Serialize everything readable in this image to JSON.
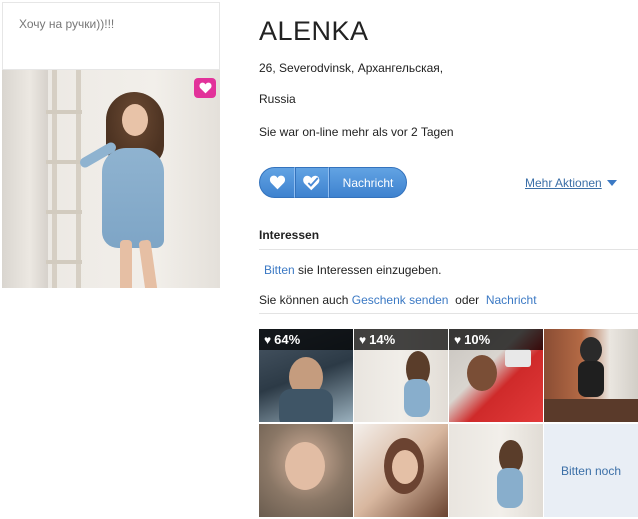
{
  "status_text": "Хочу на ручки))!!!",
  "profile": {
    "name": "ALENKA",
    "age_location": "26,  Severodvinsk, Архангельская,",
    "country": "Russia",
    "online_status": "Sie war on-line mehr als vor 2 Tagen"
  },
  "actions": {
    "message_label": "Nachricht",
    "more_actions_label": "Mehr Aktionen"
  },
  "interests": {
    "title": "Interessen",
    "prompt_link": "Bitten",
    "prompt_rest": " sie Interessen einzugeben.",
    "alt_prefix": "Sie können auch ",
    "alt_gift_link": "Geschenk senden",
    "alt_middle": "  oder  ",
    "alt_message_link": "Nachricht"
  },
  "photos": [
    {
      "match": "64%"
    },
    {
      "match": "14%"
    },
    {
      "match": "10%"
    },
    {
      "match": null
    },
    {
      "match": null
    },
    {
      "match": null
    },
    {
      "match": null
    }
  ],
  "more_photos_label": "Bitten noch",
  "colors": {
    "accent_blue": "#3b79c4",
    "like_pink": "#e2329a",
    "button_blue": "#4f93dc"
  },
  "icons": [
    "heart-icon",
    "heart-check-icon",
    "caret-down-icon"
  ]
}
